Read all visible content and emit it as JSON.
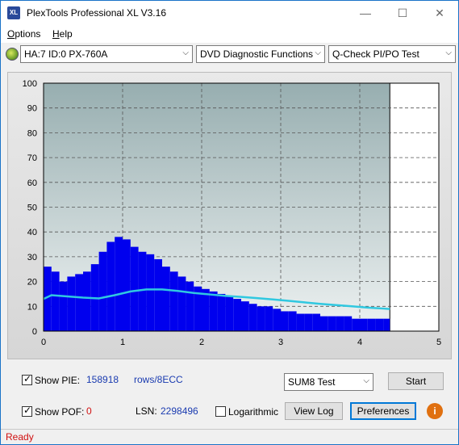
{
  "window": {
    "title": "PlexTools Professional XL V3.16",
    "icon_text": "XL"
  },
  "menu": {
    "options": "ptions",
    "options_underline": "O",
    "help": "elp",
    "help_underline": "H"
  },
  "toolbar": {
    "drive": "HA:7 ID:0  PX-760A",
    "function": "DVD Diagnostic Functions",
    "test": "Q-Check PI/PO Test"
  },
  "chart_data": {
    "type": "bar",
    "x_range": [
      0,
      5
    ],
    "ylim": [
      0,
      100
    ],
    "x_ticks": [
      "0",
      "1",
      "2",
      "3",
      "4",
      "5"
    ],
    "y_ticks": [
      "0",
      "10",
      "20",
      "30",
      "40",
      "50",
      "60",
      "70",
      "80",
      "90",
      "100"
    ],
    "data_end_x": 4.38,
    "grid": true,
    "series": [
      {
        "color": "#0000ee",
        "style": "bars",
        "x": [
          0.0,
          0.1,
          0.2,
          0.3,
          0.4,
          0.5,
          0.6,
          0.7,
          0.8,
          0.9,
          1.0,
          1.1,
          1.2,
          1.3,
          1.4,
          1.5,
          1.6,
          1.7,
          1.8,
          1.9,
          2.0,
          2.1,
          2.2,
          2.3,
          2.4,
          2.5,
          2.6,
          2.7,
          2.8,
          2.9,
          3.0,
          3.1,
          3.2,
          3.3,
          3.4,
          3.5,
          3.6,
          3.7,
          3.8,
          3.9,
          4.0,
          4.1,
          4.2,
          4.3,
          4.38
        ],
        "y": [
          26,
          24,
          20,
          22,
          23,
          24,
          27,
          32,
          36,
          38,
          37,
          34,
          32,
          31,
          29,
          26,
          24,
          22,
          20,
          18,
          17,
          16,
          15,
          14,
          13,
          12,
          11,
          10,
          10,
          9,
          8,
          8,
          7,
          7,
          7,
          6,
          6,
          6,
          6,
          5,
          5,
          5,
          5,
          5,
          4
        ]
      },
      {
        "color": "#30c8e0",
        "style": "line",
        "x": [
          0.0,
          0.1,
          0.3,
          0.5,
          0.7,
          0.9,
          1.1,
          1.3,
          1.5,
          1.7,
          1.9,
          2.1,
          2.3,
          2.5,
          2.7,
          2.9,
          3.1,
          3.3,
          3.5,
          3.7,
          3.9,
          4.1,
          4.3,
          4.38
        ],
        "y": [
          13,
          14.5,
          14,
          13.5,
          13.2,
          14.5,
          16,
          16.8,
          16.8,
          16.2,
          15.4,
          14.8,
          14.2,
          13.8,
          13.3,
          12.8,
          12.2,
          11.6,
          11,
          10.5,
          10,
          9.5,
          9.1,
          8.9
        ]
      }
    ]
  },
  "controls": {
    "show_pie_label": "Show PIE:",
    "pie_value": "158918",
    "pie_unit": "rows/8ECC",
    "show_pof_label": "Show POF:",
    "pof_value": "0",
    "lsn_label": "LSN:",
    "lsn_value": "2298496",
    "logarithmic_label": "Logarithmic",
    "sum_select": "SUM8 Test",
    "start_button": "Start",
    "view_log_button": "View Log",
    "preferences_button": "Preferences",
    "info_icon_text": "i"
  },
  "status": {
    "text": "Ready"
  },
  "colors": {
    "accent_border": "#1a73c8",
    "pie_bar": "#0000ee",
    "pie_avg_line": "#30c8e0",
    "status_text": "#d01010"
  }
}
